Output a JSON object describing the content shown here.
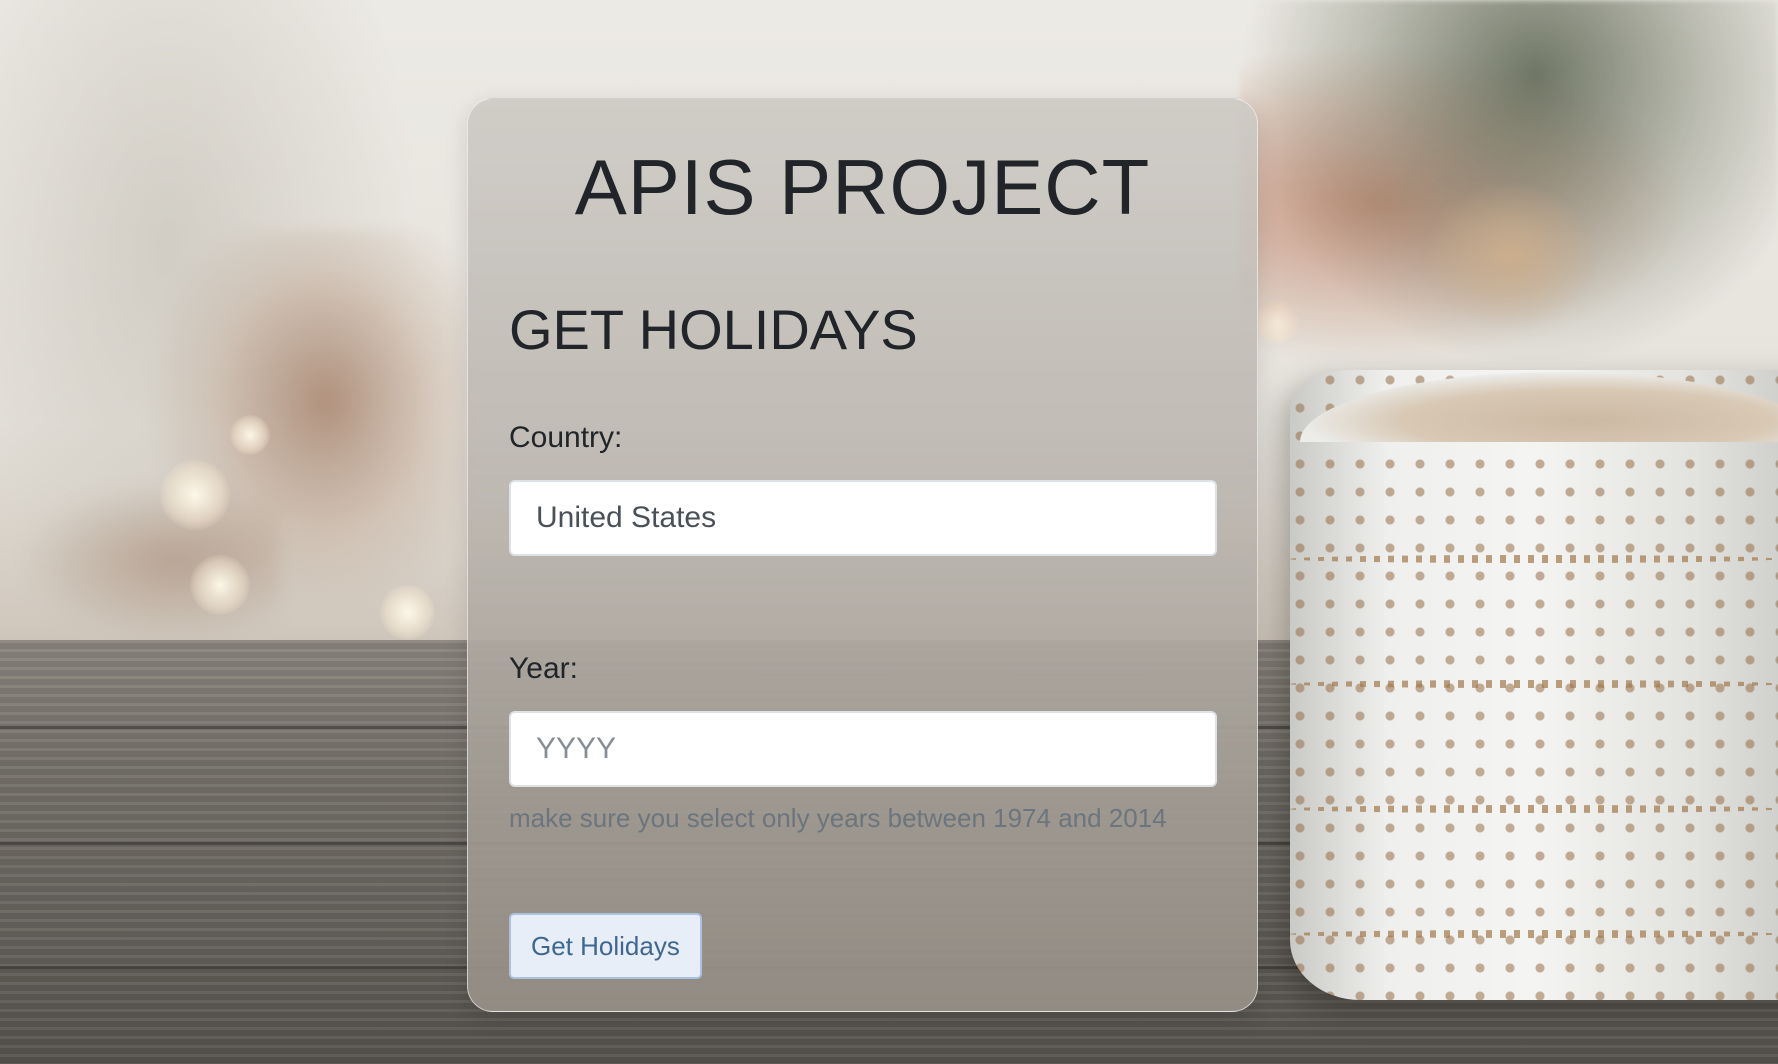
{
  "app": {
    "title": "APIS PROJECT"
  },
  "form": {
    "heading": "GET HOLIDAYS",
    "country_label": "Country:",
    "country_value": "United States",
    "year_label": "Year:",
    "year_placeholder": "YYYY",
    "year_value": "",
    "year_help": "make sure you select only years between 1974 and 2014",
    "submit_label": "Get Holidays"
  },
  "theme": {
    "card_background": "#b9b4ad",
    "text_color": "#212529",
    "help_text_color": "#6c757d",
    "button_background": "#e7eef7",
    "button_border": "#a9c3de",
    "button_text": "#3f6790"
  }
}
